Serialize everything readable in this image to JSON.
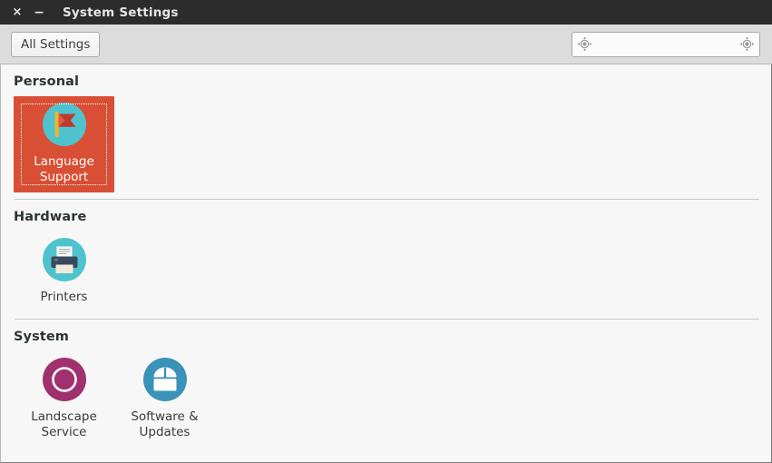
{
  "window": {
    "title": "System Settings",
    "close_label": "×",
    "minimize_label": "−",
    "close_icon": "close-icon",
    "minimize_icon": "minimize-icon"
  },
  "toolbar": {
    "all_settings_label": "All Settings",
    "search": {
      "value": "",
      "placeholder": "",
      "left_icon": "target-icon",
      "right_icon": "target-icon"
    }
  },
  "colors": {
    "titlebar_bg": "#2c2c2c",
    "toolbar_bg": "#dcdcdc",
    "content_bg": "#f7f7f7",
    "selection_bg": "#d94f35",
    "selection_text": "#ffffff",
    "heading_text": "#2e3436",
    "label_text": "#3a3a3a",
    "separator": "#c9c9c9",
    "icon_cyan": "#4ec3ce",
    "icon_flag_red": "#c0392b",
    "icon_flag_pole": "#f0b429",
    "icon_printer_body": "#394a5a",
    "icon_printer_paper": "#ffffff",
    "icon_printer_tray": "#f2ead7",
    "icon_landscape_magenta": "#a0316e",
    "icon_software_blue": "#3a92b8"
  },
  "groups": [
    {
      "title": "Personal",
      "separator_above": false,
      "items": [
        {
          "label": "Language\nSupport",
          "icon": "language-flag-icon",
          "selected": true
        }
      ]
    },
    {
      "title": "Hardware",
      "separator_above": true,
      "items": [
        {
          "label": "Printers",
          "icon": "printer-icon",
          "selected": false
        }
      ]
    },
    {
      "title": "System",
      "separator_above": true,
      "items": [
        {
          "label": "Landscape\nService",
          "icon": "landscape-service-icon",
          "selected": false
        },
        {
          "label": "Software &\nUpdates",
          "icon": "software-updates-icon",
          "selected": false
        }
      ]
    }
  ]
}
